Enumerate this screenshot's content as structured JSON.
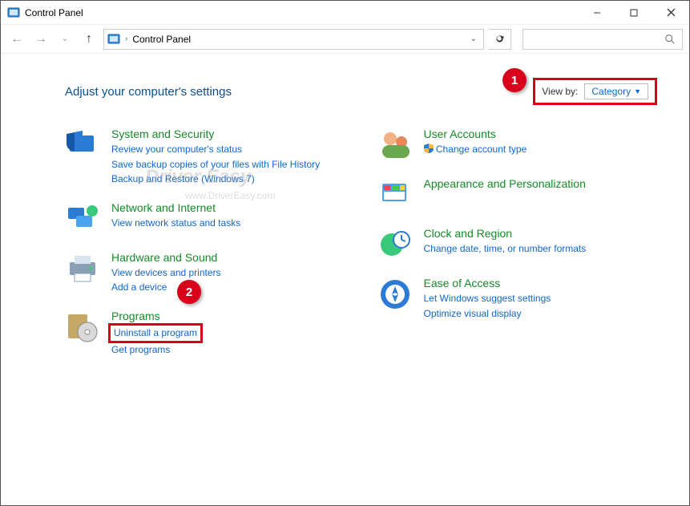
{
  "window": {
    "title": "Control Panel"
  },
  "address": {
    "root": "Control Panel"
  },
  "heading": "Adjust your computer's settings",
  "viewby": {
    "label": "View by:",
    "value": "Category"
  },
  "callouts": {
    "one": "1",
    "two": "2"
  },
  "watermark": {
    "line1": "Driver Easy",
    "line2": "www.DriverEasy.com"
  },
  "left_categories": [
    {
      "title": "System and Security",
      "links": [
        "Review your computer's status",
        "Save backup copies of your files with File History",
        "Backup and Restore (Windows 7)"
      ]
    },
    {
      "title": "Network and Internet",
      "links": [
        "View network status and tasks"
      ]
    },
    {
      "title": "Hardware and Sound",
      "links": [
        "View devices and printers",
        "Add a device"
      ]
    },
    {
      "title": "Programs",
      "links": [
        "Uninstall a program",
        "Get programs"
      ]
    }
  ],
  "right_categories": [
    {
      "title": "User Accounts",
      "links": [
        "Change account type"
      ],
      "link_badge": "shield"
    },
    {
      "title": "Appearance and Personalization",
      "links": []
    },
    {
      "title": "Clock and Region",
      "links": [
        "Change date, time, or number formats"
      ]
    },
    {
      "title": "Ease of Access",
      "links": [
        "Let Windows suggest settings",
        "Optimize visual display"
      ]
    }
  ]
}
